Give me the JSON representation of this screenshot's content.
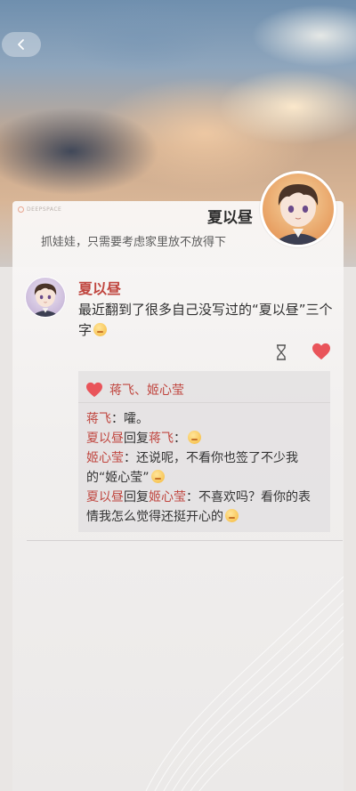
{
  "profile": {
    "name": "夏以昼",
    "bio": "抓娃娃，只需要考虑家里放不放得下",
    "brand": "DEEPSPACE"
  },
  "post": {
    "author": "夏以昼",
    "text": "最近翻到了很多自己没写过的“夏以昼”三个字"
  },
  "likes": {
    "names": "蒋飞、姬心莹"
  },
  "comments": [
    {
      "author": "蒋飞",
      "text": "：嚯。"
    },
    {
      "author": "夏以昼",
      "reply_word": "回复",
      "target": "蒋飞",
      "text": "："
    },
    {
      "author": "姬心莹",
      "text": "：还说呢，不看你也签了不少我的“姬心莹”"
    },
    {
      "author": "夏以昼",
      "reply_word": "回复",
      "target": "姬心莹",
      "text": "：不喜欢吗？看你的表情我怎么觉得还挺开心的"
    }
  ],
  "colors": {
    "accent": "#c0463f",
    "heart": "#e9545a"
  },
  "icons": {
    "back": "chevron-left-icon",
    "like": "heart-icon",
    "timer": "hourglass-icon"
  }
}
